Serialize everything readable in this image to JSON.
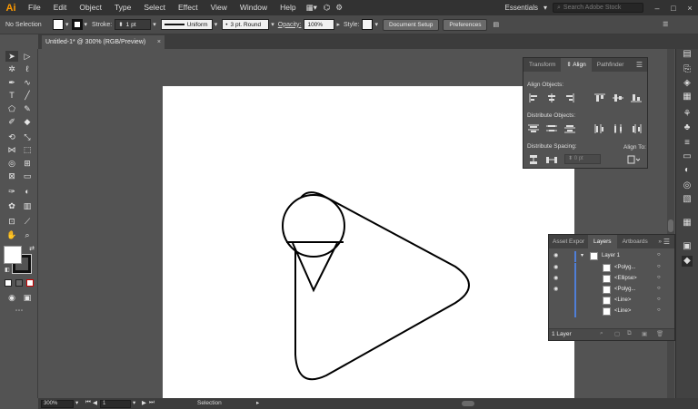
{
  "app": {
    "logo": "Ai"
  },
  "menu": [
    "File",
    "Edit",
    "Object",
    "Type",
    "Select",
    "Effect",
    "View",
    "Window",
    "Help"
  ],
  "workspace": {
    "name": "Essentials",
    "search_placeholder": "Search Adobe Stock"
  },
  "control_bar": {
    "selection_label": "No Selection",
    "stroke_label": "Stroke:",
    "stroke_weight": "1 pt",
    "profile": "Uniform",
    "brush": "3 pt. Round",
    "opacity_label": "Opacity:",
    "opacity_value": "100%",
    "style_label": "Style:",
    "document_setup": "Document Setup",
    "preferences": "Preferences"
  },
  "document_tab": {
    "title": "Untitled-1* @ 300% (RGB/Preview)",
    "close": "×"
  },
  "align_panel": {
    "tabs": [
      "Transform",
      "Align",
      "Pathfinder"
    ],
    "active_tab": "Align",
    "align_objects": "Align Objects:",
    "distribute_objects": "Distribute Objects:",
    "distribute_spacing": "Distribute Spacing:",
    "align_to": "Align To:",
    "spacing_value": "0 pt"
  },
  "layers_panel": {
    "tabs": [
      "Asset Expor",
      "Layers",
      "Artboards"
    ],
    "active_tab": "Layers",
    "layer_name": "Layer 1",
    "items": [
      "<Polyg...",
      "<Ellipse>",
      "<Polyg...",
      "<Line>",
      "<Line>"
    ],
    "footer": "1 Layer"
  },
  "status_bar": {
    "zoom": "300%",
    "artboard_number": "1",
    "tool": "Selection"
  },
  "colors": {
    "accent": "#ff9a00",
    "layer_color": "#4f7fd8",
    "canvas": "#535353",
    "artboard": "#ffffff"
  }
}
